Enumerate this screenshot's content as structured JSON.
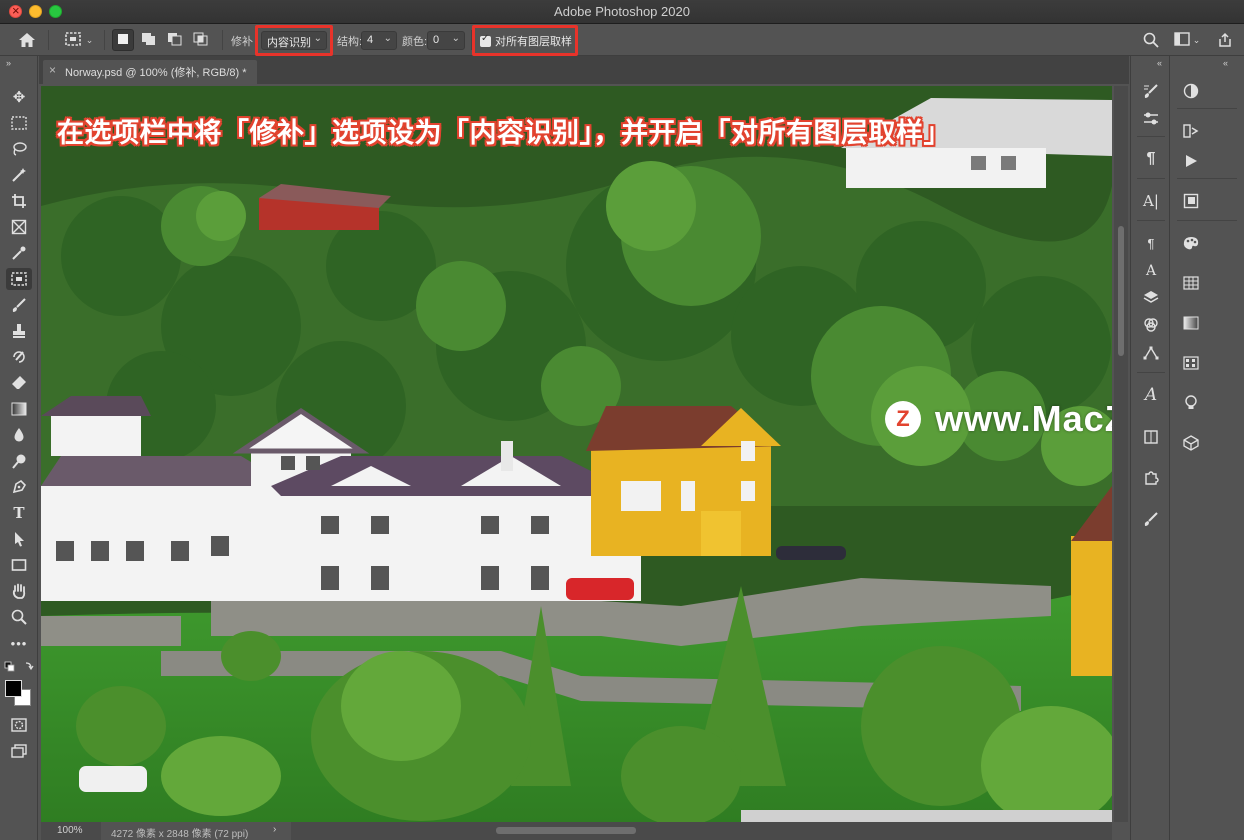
{
  "window": {
    "title": "Adobe Photoshop 2020"
  },
  "options_bar": {
    "patch_label": "修补",
    "patch_value": "内容识别",
    "structure_label": "结构:",
    "structure_value": "4",
    "color_label": "颜色:",
    "color_value": "0",
    "sample_all_layers_label": "对所有图层取样",
    "sample_all_layers_checked": true
  },
  "document": {
    "tab_label": "Norway.psd @ 100% (修补, RGB/8) *",
    "close_symbol": "×"
  },
  "canvas": {
    "annotation": "在选项栏中将「修补」选项设为「内容识别」，并开启「对所有图层取样」",
    "watermark_logo": "Z",
    "watermark_text": "www.MacZ.com"
  },
  "status_bar": {
    "zoom": "100%",
    "doc_info": "4272 像素 x 2848 像素 (72 ppi)",
    "arrow": "›"
  },
  "colors": {
    "highlight_red": "#e8332a",
    "annotation_stroke": "#e2432f",
    "ui_bg": "#535353"
  },
  "tools": [
    "move-tool-icon",
    "marquee-tool-icon",
    "lasso-tool-icon",
    "magic-wand-tool-icon",
    "crop-tool-icon",
    "frame-tool-icon",
    "eyedropper-tool-icon",
    "patch-tool-icon",
    "brush-tool-icon",
    "clone-stamp-tool-icon",
    "history-brush-tool-icon",
    "eraser-tool-icon",
    "gradient-tool-icon",
    "blur-tool-icon",
    "dodge-tool-icon",
    "pen-tool-icon",
    "type-tool-icon",
    "path-selection-tool-icon",
    "rectangle-tool-icon",
    "hand-tool-icon",
    "zoom-tool-icon",
    "more-tools-icon"
  ]
}
